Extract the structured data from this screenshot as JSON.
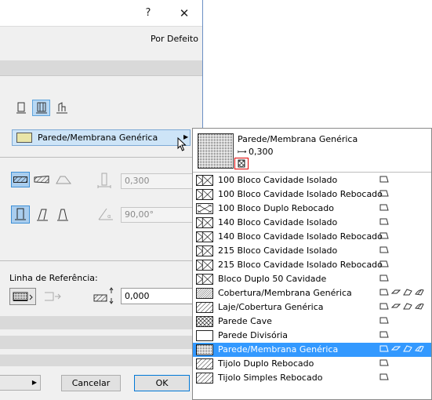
{
  "title_bar": {
    "help": "?",
    "close": "✕"
  },
  "dialog": {
    "default_label": "Por Defeito",
    "fill_selector": "Parede/Membrana Genérica",
    "thickness": "0,300",
    "angle": "90,00°",
    "reference_line_label": "Linha de Referência:",
    "offset": "0,000",
    "cancel": "Cancelar",
    "ok": "OK"
  },
  "popup": {
    "preview_name": "Parede/Membrana Genérica",
    "preview_thickness": "0,300",
    "items": [
      {
        "name": "100 Bloco Cavidade Isolado",
        "pattern": "block",
        "icons": [
          "wall"
        ]
      },
      {
        "name": "100 Bloco Cavidade Isolado Rebocado",
        "pattern": "block",
        "icons": [
          "wall"
        ]
      },
      {
        "name": "100 Bloco Duplo Rebocado",
        "pattern": "block2",
        "icons": [
          "wall"
        ]
      },
      {
        "name": "140 Bloco Cavidade Isolado",
        "pattern": "block",
        "icons": [
          "wall"
        ]
      },
      {
        "name": "140 Bloco Cavidade Isolado Rebocado",
        "pattern": "block",
        "icons": [
          "wall"
        ]
      },
      {
        "name": "215 Bloco Cavidade Isolado",
        "pattern": "block",
        "icons": [
          "wall"
        ]
      },
      {
        "name": "215 Bloco Cavidade Isolado Rebocado",
        "pattern": "block",
        "icons": [
          "wall"
        ]
      },
      {
        "name": "Bloco Duplo 50 Cavidade",
        "pattern": "block",
        "icons": [
          "wall"
        ]
      },
      {
        "name": "Cobertura/Membrana Genérica",
        "pattern": "dense",
        "icons": [
          "wall",
          "slab",
          "roof",
          "shell"
        ]
      },
      {
        "name": "Laje/Cobertura Genérica",
        "pattern": "hatch",
        "icons": [
          "wall",
          "slab",
          "roof",
          "shell"
        ]
      },
      {
        "name": "Parede Cave",
        "pattern": "cross",
        "icons": [
          "wall"
        ]
      },
      {
        "name": "Parede Divisória",
        "pattern": "empty",
        "icons": [
          "wall"
        ]
      },
      {
        "name": "Parede/Membrana Genérica",
        "pattern": "dots",
        "icons": [
          "wall",
          "slab",
          "roof",
          "shell"
        ],
        "selected": true
      },
      {
        "name": "Tijolo Duplo Rebocado",
        "pattern": "hatch",
        "icons": [
          "wall"
        ]
      },
      {
        "name": "Tijolo Simples Rebocado",
        "pattern": "hatch",
        "icons": [
          "wall"
        ]
      }
    ]
  }
}
